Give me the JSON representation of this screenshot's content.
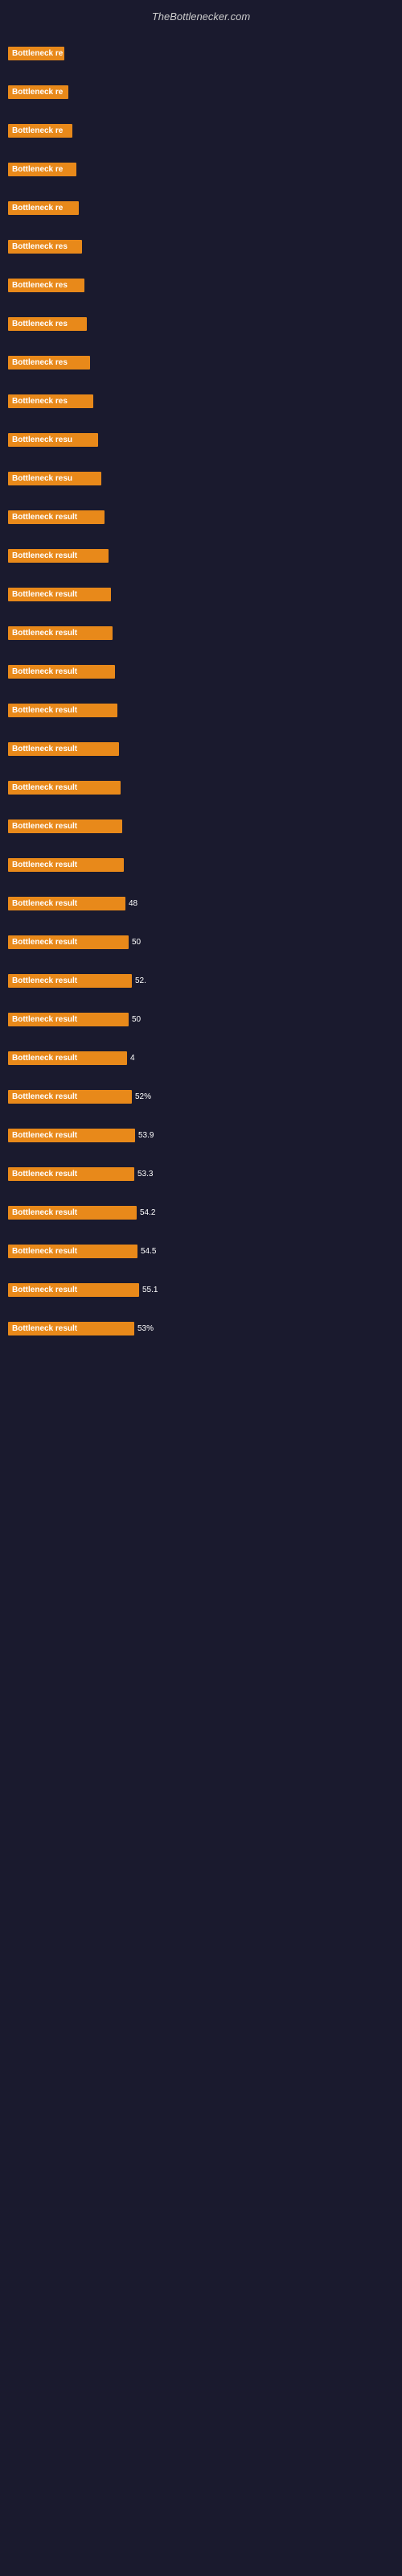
{
  "header": {
    "title": "TheBottlenecker.com"
  },
  "rows": [
    {
      "label": "Bottleneck re",
      "value": "",
      "width": 70
    },
    {
      "label": "Bottleneck re",
      "value": "",
      "width": 75
    },
    {
      "label": "Bottleneck re",
      "value": "",
      "width": 80
    },
    {
      "label": "Bottleneck re",
      "value": "",
      "width": 85
    },
    {
      "label": "Bottleneck re",
      "value": "",
      "width": 88
    },
    {
      "label": "Bottleneck res",
      "value": "",
      "width": 92
    },
    {
      "label": "Bottleneck res",
      "value": "",
      "width": 95
    },
    {
      "label": "Bottleneck res",
      "value": "",
      "width": 98
    },
    {
      "label": "Bottleneck res",
      "value": "",
      "width": 102
    },
    {
      "label": "Bottleneck res",
      "value": "",
      "width": 106
    },
    {
      "label": "Bottleneck resu",
      "value": "",
      "width": 112
    },
    {
      "label": "Bottleneck resu",
      "value": "",
      "width": 116
    },
    {
      "label": "Bottleneck result",
      "value": "",
      "width": 120
    },
    {
      "label": "Bottleneck result",
      "value": "",
      "width": 125
    },
    {
      "label": "Bottleneck result",
      "value": "",
      "width": 128
    },
    {
      "label": "Bottleneck result",
      "value": "",
      "width": 130
    },
    {
      "label": "Bottleneck result",
      "value": "",
      "width": 133
    },
    {
      "label": "Bottleneck result",
      "value": "",
      "width": 136
    },
    {
      "label": "Bottleneck result",
      "value": "",
      "width": 138
    },
    {
      "label": "Bottleneck result",
      "value": "",
      "width": 140
    },
    {
      "label": "Bottleneck result",
      "value": "",
      "width": 142
    },
    {
      "label": "Bottleneck result",
      "value": "",
      "width": 144
    },
    {
      "label": "Bottleneck result",
      "value": "48",
      "width": 146
    },
    {
      "label": "Bottleneck result",
      "value": "50",
      "width": 150
    },
    {
      "label": "Bottleneck result",
      "value": "52.",
      "width": 154
    },
    {
      "label": "Bottleneck result",
      "value": "50",
      "width": 150
    },
    {
      "label": "Bottleneck result",
      "value": "4",
      "width": 148
    },
    {
      "label": "Bottleneck result",
      "value": "52%",
      "width": 154
    },
    {
      "label": "Bottleneck result",
      "value": "53.9",
      "width": 158
    },
    {
      "label": "Bottleneck result",
      "value": "53.3",
      "width": 157
    },
    {
      "label": "Bottleneck result",
      "value": "54.2",
      "width": 160
    },
    {
      "label": "Bottleneck result",
      "value": "54.5",
      "width": 161
    },
    {
      "label": "Bottleneck result",
      "value": "55.1",
      "width": 163
    },
    {
      "label": "Bottleneck result",
      "value": "53%",
      "width": 157
    }
  ]
}
